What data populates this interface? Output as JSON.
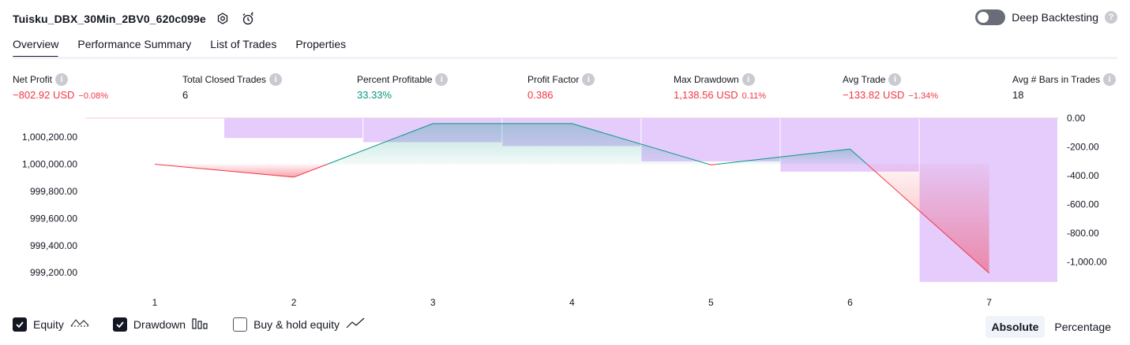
{
  "header": {
    "strategy_name": "Tuisku_DBX_30Min_2BV0_620c099e",
    "settings_icon": "gear-icon",
    "alert_icon": "alarm-clock-icon"
  },
  "deep_backtesting": {
    "label": "Deep Backtesting",
    "enabled": false,
    "help": "?"
  },
  "tabs": [
    {
      "label": "Overview",
      "active": true
    },
    {
      "label": "Performance Summary",
      "active": false
    },
    {
      "label": "List of Trades",
      "active": false
    },
    {
      "label": "Properties",
      "active": false
    }
  ],
  "metrics": [
    {
      "label": "Net Profit",
      "value": "−802.92 USD",
      "sub": "−0.08%",
      "color": "red"
    },
    {
      "label": "Total Closed Trades",
      "value": "6",
      "sub": "",
      "color": "dark"
    },
    {
      "label": "Percent Profitable",
      "value": "33.33%",
      "sub": "",
      "color": "green"
    },
    {
      "label": "Profit Factor",
      "value": "0.386",
      "sub": "",
      "color": "red"
    },
    {
      "label": "Max Drawdown",
      "value": "1,138.56 USD",
      "sub": "0.11%",
      "color": "red"
    },
    {
      "label": "Avg Trade",
      "value": "−133.82 USD",
      "sub": "−1.34%",
      "color": "red"
    },
    {
      "label": "Avg # Bars in Trades",
      "value": "18",
      "sub": "",
      "color": "dark"
    }
  ],
  "chart_data": {
    "type": "line",
    "x": [
      1,
      2,
      3,
      4,
      5,
      6,
      7
    ],
    "x_ticks": [
      "1",
      "2",
      "3",
      "4",
      "5",
      "6",
      "7"
    ],
    "equity": {
      "values": [
        1000000.0,
        999904.84,
        1000300.0,
        1000300.0,
        999995.0,
        1000112.0,
        999197.08
      ],
      "baseline": 1000000.0,
      "ylim": [
        999120.0,
        1000340.0
      ],
      "y_ticks": [
        "1,000,200.00",
        "1,000,000.00",
        "999,800.00",
        "999,600.00",
        "999,400.00",
        "999,200.00"
      ],
      "y_tick_values": [
        1000200,
        1000000,
        999800,
        999600,
        999400,
        999200
      ],
      "color_up": "#089981",
      "color_down": "#f23645"
    },
    "drawdown": {
      "values": [
        0,
        -138,
        -167,
        -194,
        -301,
        -372,
        -1138.56
      ],
      "ylim": [
        -1150,
        0
      ],
      "y_ticks": [
        "0.00",
        "-200.00",
        "-400.00",
        "-600.00",
        "-800.00",
        "-1,000.00"
      ],
      "y_tick_values": [
        0,
        -200,
        -400,
        -600,
        -800,
        -1000
      ],
      "color": "#e1c3fd"
    },
    "grid": false
  },
  "legend": [
    {
      "label": "Equity",
      "checked": true,
      "icon": "equity-line-icon"
    },
    {
      "label": "Drawdown",
      "checked": true,
      "icon": "drawdown-bars-icon"
    },
    {
      "label": "Buy & hold equity",
      "checked": false,
      "icon": "buy-hold-line-icon"
    }
  ],
  "modes": [
    {
      "label": "Absolute",
      "active": true
    },
    {
      "label": "Percentage",
      "active": false
    }
  ]
}
